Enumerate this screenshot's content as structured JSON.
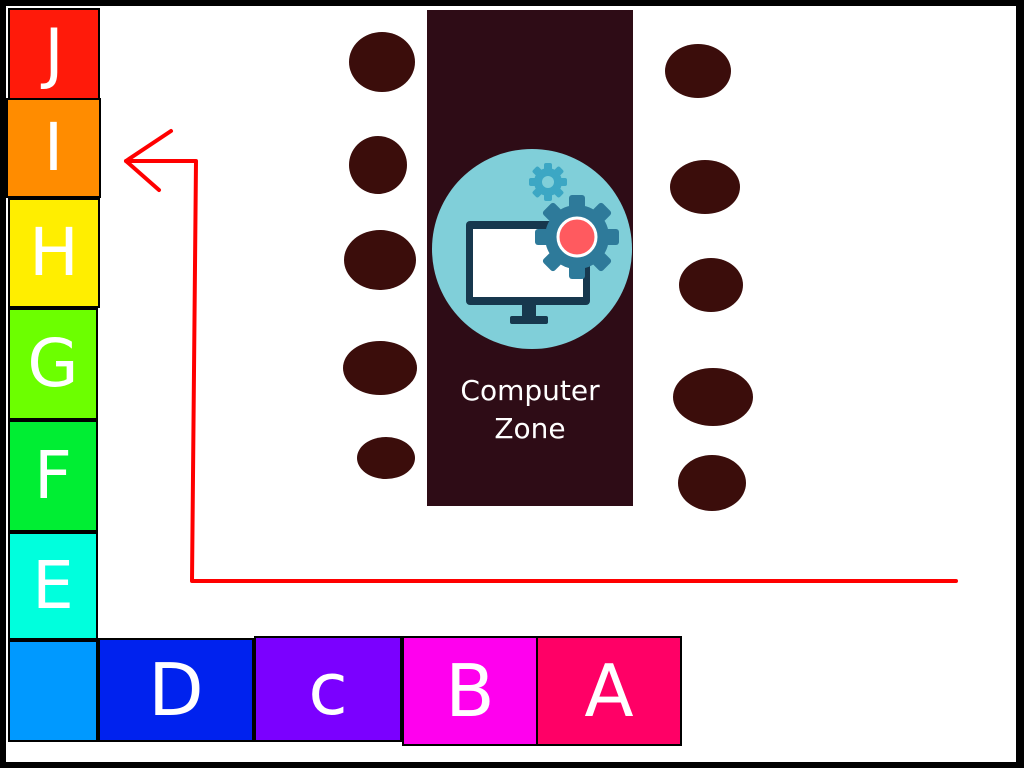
{
  "zones_vertical": [
    {
      "label": "J",
      "color": "#ff1a0a"
    },
    {
      "label": "I",
      "color": "#ff8c00"
    },
    {
      "label": "H",
      "color": "#ffee00"
    },
    {
      "label": "G",
      "color": "#6cff00"
    },
    {
      "label": "F",
      "color": "#00ee33"
    },
    {
      "label": "E",
      "color": "#00ffdd"
    }
  ],
  "zones_horizontal": [
    {
      "label": "",
      "color": "#0099ff"
    },
    {
      "label": "D",
      "color": "#0022ee"
    },
    {
      "label": "c",
      "color": "#7b00ff"
    },
    {
      "label": "B",
      "color": "#ff00ee"
    },
    {
      "label": "A",
      "color": "#ff0066"
    }
  ],
  "table": {
    "label": "Computer\nZone",
    "color": "#2e0c16",
    "icon": "computer-settings-icon"
  },
  "chair_color": "#3b0d0b",
  "arrow_color": "#ff0000"
}
